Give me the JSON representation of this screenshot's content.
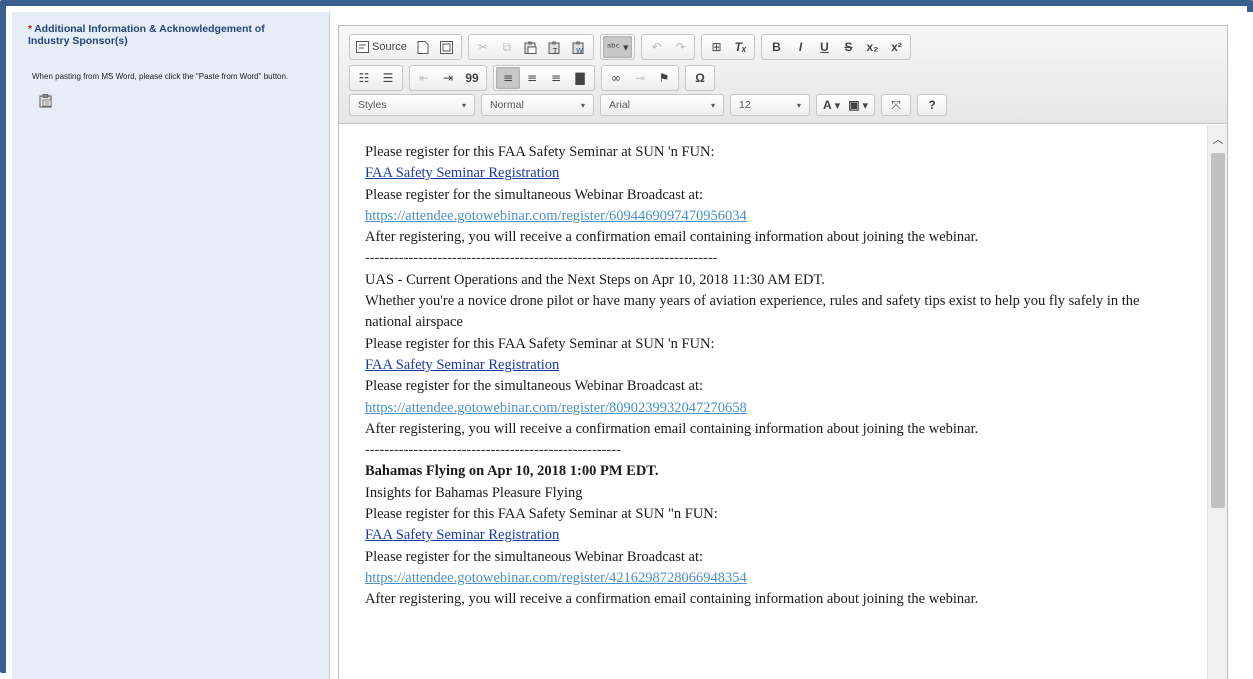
{
  "field": {
    "required_mark": "*",
    "label": "Additional Information & Acknowledgement of Industry Sponsor(s)",
    "hint": "When pasting from MS Word, please click the \"Paste from Word\" button.",
    "paste_word_icon": "paste-from-word-icon"
  },
  "toolbar": {
    "source_label": "Source",
    "styles_label": "Styles",
    "format_label": "Normal",
    "font_label": "Arial",
    "size_label": "12",
    "bold_glyph": "B",
    "italic_glyph": "I",
    "underline_glyph": "U",
    "strike_glyph": "S",
    "subscript_glyph": "x₂",
    "superscript_glyph": "x²",
    "text_color_glyph": "A",
    "bg_color_glyph": "▣",
    "omega_glyph": "Ω",
    "help_glyph": "?",
    "quote_glyph": "99",
    "clear_format_glyph": "Tₓ",
    "dropdown_arrow": "▾"
  },
  "content": {
    "lines": [
      {
        "text": "Please register for this FAA Safety Seminar at SUN 'n FUN:"
      },
      {
        "link": "FAA Safety Seminar Registration"
      },
      {
        "text": "Please register for the simultaneous Webinar Broadcast at:"
      },
      {
        "url": "https://attendee.gotowebinar.com/register/6094469097470956034"
      },
      {
        "text": "After registering, you will receive a confirmation email containing information about joining the webinar."
      },
      {
        "sep": "-------------------------------------------------------------------------"
      },
      {
        "text": "UAS - Current Operations and the Next Steps on Apr 10, 2018 11:30 AM EDT."
      },
      {
        "wrap": "Whether you're a novice drone pilot or have many years of aviation experience, rules and safety tips exist to help you fly safely in the national airspace"
      },
      {
        "text": "Please register for this FAA Safety Seminar at SUN 'n FUN:"
      },
      {
        "link": "FAA Safety Seminar Registration"
      },
      {
        "text": "Please register for the simultaneous Webinar Broadcast at:"
      },
      {
        "url": "https://attendee.gotowebinar.com/register/8090239932047270658"
      },
      {
        "text": "After registering, you will receive a confirmation email containing information about joining the webinar."
      },
      {
        "sep": "-----------------------------------------------------"
      },
      {
        "bold": "Bahamas Flying on Apr 10, 2018 1:00 PM EDT."
      },
      {
        "text": "Insights for Bahamas Pleasure Flying"
      },
      {
        "text": "Please register for this FAA Safety Seminar at SUN \"n FUN:"
      },
      {
        "link": "FAA Safety Seminar Registration"
      },
      {
        "text": "Please register for the simultaneous Webinar Broadcast at:"
      },
      {
        "url": "https://attendee.gotowebinar.com/register/4216298728066948354"
      },
      {
        "text": "After registering, you will receive a confirmation email containing information about joining the webinar."
      }
    ]
  },
  "colors": {
    "frame": "#3a5f8f",
    "label": "#24467a",
    "required": "#cc2222",
    "link": "#1a3aa8",
    "url": "#4a8fc9"
  }
}
